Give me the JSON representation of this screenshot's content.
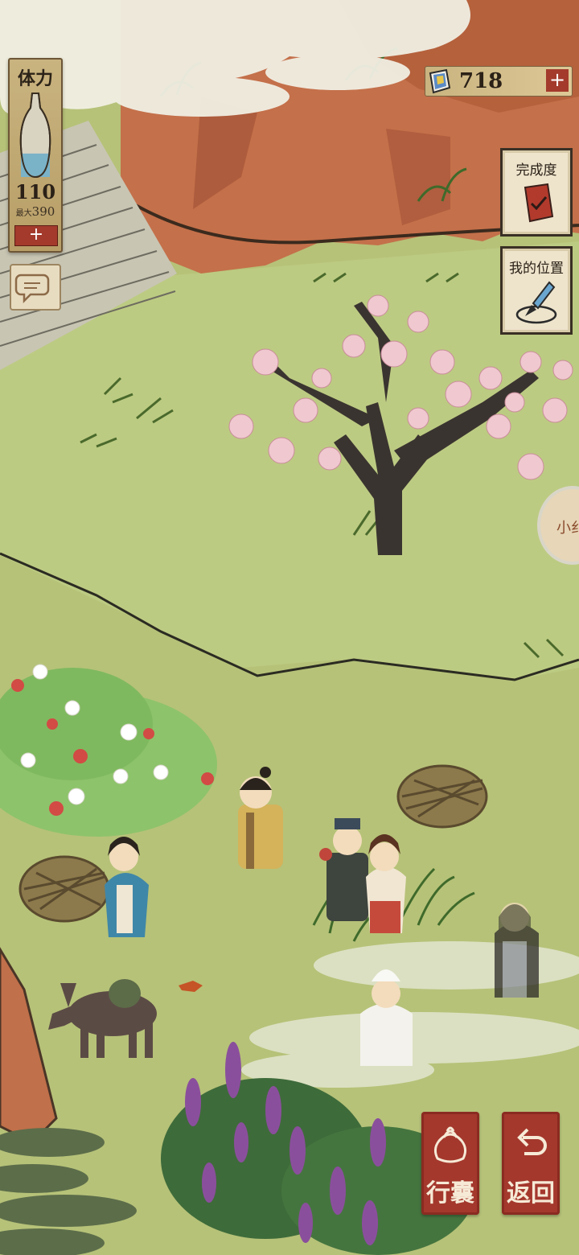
{
  "hud": {
    "stamina": {
      "title": "体力",
      "value": "110",
      "max_label": "最大",
      "max_value": "390",
      "add_symbol": "+",
      "level": 0.28
    },
    "currency": {
      "icon": "gem-icon",
      "value": "718",
      "add_symbol": "+"
    },
    "chat": {
      "icon": "chat-bubbles-icon"
    }
  },
  "side_panel": {
    "completion": {
      "label": "完成度",
      "icon": "red-book-icon"
    },
    "location": {
      "label": "我的位置",
      "icon": "brush-icon"
    },
    "edge_tab": {
      "label": "小纟"
    }
  },
  "bottom_buttons": {
    "bag": {
      "label": "行囊",
      "icon": "cloth-bundle-icon"
    },
    "back": {
      "label": "返回",
      "icon": "return-arrow-icon"
    }
  },
  "colors": {
    "grass": "#b6c278",
    "rock": "#c4704a",
    "seal_red": "#a4382d",
    "parchment": "#c9b37f",
    "blossom": "#f0c8d0",
    "flower_purple": "#8a4f9c"
  }
}
